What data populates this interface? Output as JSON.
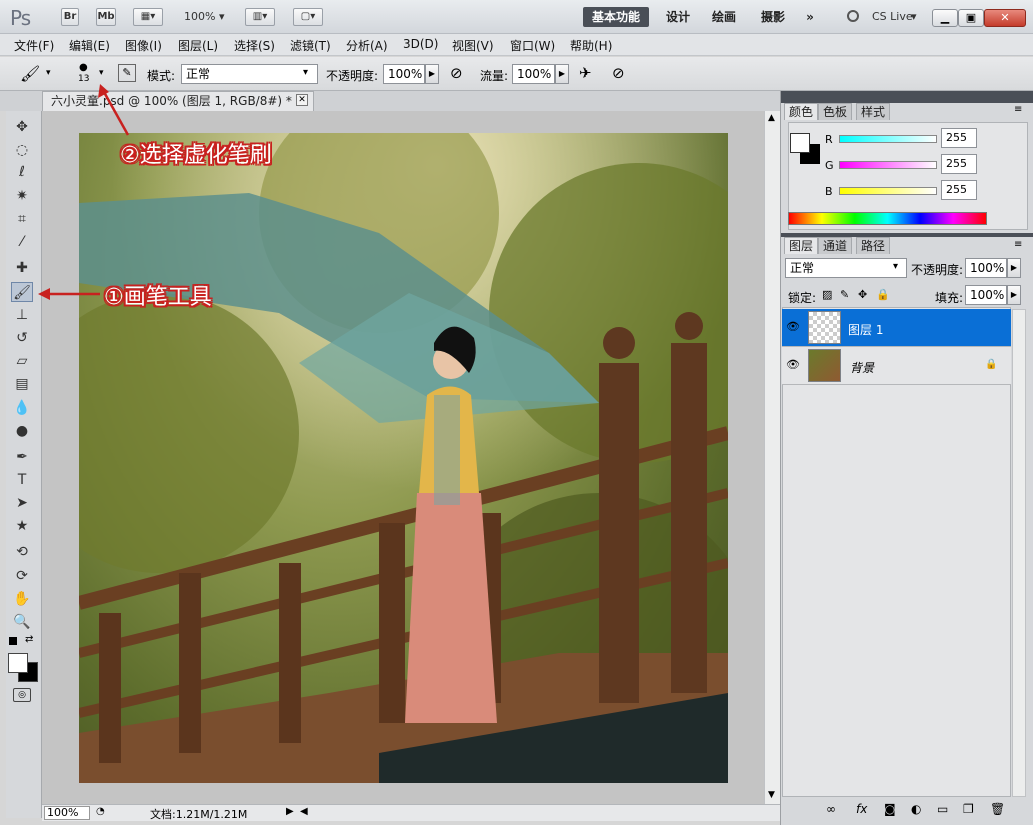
{
  "app": {
    "logo": "Ps",
    "bridge": "Br",
    "minibridge": "Mb",
    "zoom": "100%",
    "cslive": "CS Live"
  },
  "workspaces": [
    "基本功能",
    "设计",
    "绘画",
    "摄影",
    "»"
  ],
  "menu": [
    "文件(F)",
    "编辑(E)",
    "图像(I)",
    "图层(L)",
    "选择(S)",
    "滤镜(T)",
    "分析(A)",
    "3D(D)",
    "视图(V)",
    "窗口(W)",
    "帮助(H)"
  ],
  "options": {
    "brush_size": "13",
    "mode_label": "模式:",
    "mode_value": "正常",
    "opacity_label": "不透明度:",
    "opacity_value": "100%",
    "flow_label": "流量:",
    "flow_value": "100%"
  },
  "document": {
    "tab_title": "六小灵童.psd @ 100% (图层 1, RGB/8#) *",
    "zoom": "100%",
    "doc_info": "文档:1.21M/1.21M"
  },
  "color_panel": {
    "tabs": [
      "颜色",
      "色板",
      "样式"
    ],
    "r_label": "R",
    "g_label": "G",
    "b_label": "B",
    "r": "255",
    "g": "255",
    "b": "255"
  },
  "layers_panel": {
    "tabs": [
      "图层",
      "通道",
      "路径"
    ],
    "blend_mode": "正常",
    "opacity_label": "不透明度:",
    "opacity_value": "100%",
    "lock_label": "锁定:",
    "fill_label": "填充:",
    "fill_value": "100%",
    "layers": [
      {
        "name": "图层 1"
      },
      {
        "name": "背景"
      }
    ]
  },
  "annotations": {
    "step1": "①画笔工具",
    "step2": "②选择虚化笔刷"
  },
  "colors": {
    "accent": "#0a6fd6",
    "annotation": "#c8211f"
  }
}
